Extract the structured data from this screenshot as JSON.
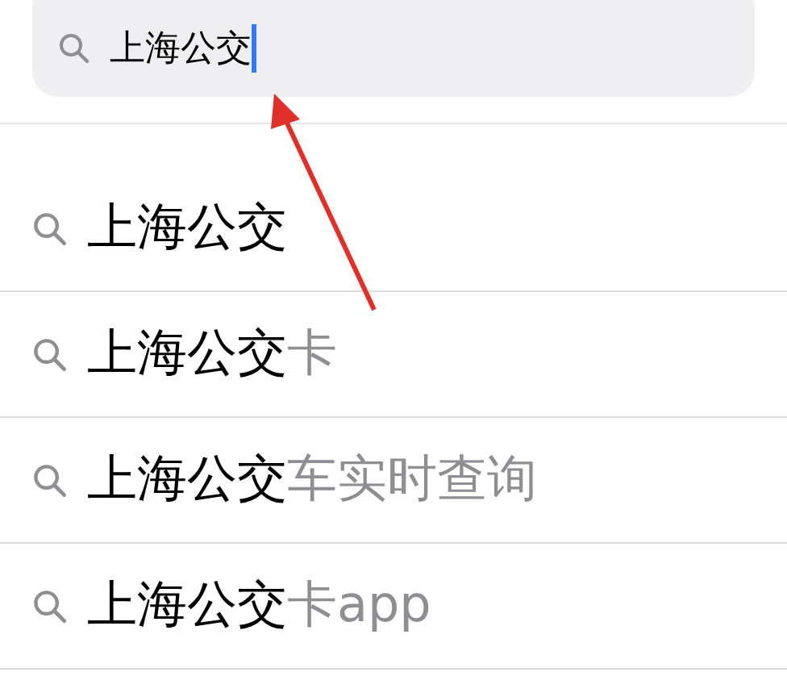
{
  "search": {
    "value": "上海公交",
    "focused": true
  },
  "suggestions": [
    {
      "match": "上海公交"
    },
    {
      "match": "上海公交",
      "rest": "卡"
    },
    {
      "match": "上海公交",
      "rest": "车实时查询"
    },
    {
      "match": "上海公交",
      "rest": "卡app"
    }
  ]
}
